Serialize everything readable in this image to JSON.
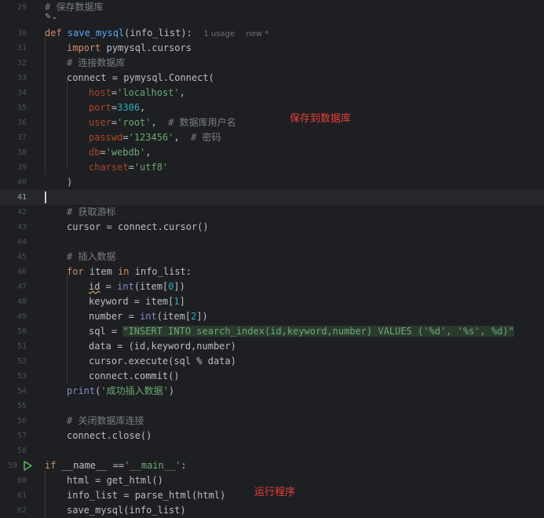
{
  "editor": {
    "line_numbers": [
      "29",
      "30",
      "31",
      "32",
      "33",
      "34",
      "35",
      "36",
      "37",
      "38",
      "39",
      "40",
      "41",
      "42",
      "43",
      "44",
      "45",
      "46",
      "47",
      "48",
      "49",
      "50",
      "51",
      "52",
      "53",
      "54",
      "55",
      "56",
      "57",
      "58",
      "59",
      "60",
      "61",
      "62"
    ],
    "comment_save_db": "# 保存数据库",
    "ai_hint": "✎⌄",
    "def_kw": "def",
    "def_name": "save_mysql",
    "def_params": "(info_list):",
    "usage_hint": "1 usage",
    "new_hint": "new *",
    "import_kw": "import",
    "import_mod": "pymysql.cursors",
    "comment_connect": "# 连接数据库",
    "connect_line": "connect = pymysql.Connect(",
    "host_key": "host",
    "host_val": "'localhost'",
    "port_key": "port",
    "port_val": "3306",
    "user_key": "user",
    "user_val": "'root'",
    "user_comment": "# 数据库用户名",
    "passwd_key": "passwd",
    "passwd_val": "'123456'",
    "passwd_comment": "# 密码",
    "db_key": "db",
    "db_val": "'webdb'",
    "charset_key": "charset",
    "charset_val": "'utf8'",
    "close_paren": ")",
    "comment_cursor": "# 获取游标",
    "cursor_line": "cursor = connect.cursor()",
    "comment_insert": "# 插入数据",
    "for_kw": "for",
    "for_var": "item",
    "in_kw": "in",
    "for_iter": "info_list:",
    "id_var": "id",
    "int_fn": "int",
    "item0": "(item[",
    "idx0": "0",
    "idx_close": "])",
    "keyword_line": "keyword = item[",
    "idx1": "1",
    "bracket_close": "]",
    "number_line": "number = ",
    "item2": "(item[",
    "idx2": "2",
    "sql_prefix": "sql = ",
    "sql_string": "\"INSERT INTO search_index(id,keyword,number) VALUES ('%d', '%s', %d)\"",
    "data_line": "data = (id,keyword,number)",
    "execute_line": "cursor.execute(sql % data)",
    "commit_line": "connect.commit()",
    "print_fn": "print",
    "print_arg": "'成功插入数据'",
    "comment_close": "# 关闭数据库连接",
    "close_line": "connect.close()",
    "if_kw": "if",
    "main_cond_a": "__name__ ==",
    "main_str": "'__main__'",
    "main_colon": ":",
    "html_line": "html = get_html()",
    "parse_line": "info_list = parse_html(html)",
    "save_call": "save_mysql(info_list)"
  },
  "annotations": {
    "save_label": "保存到数据库",
    "run_label": "运行程序"
  },
  "colors": {
    "background": "#1e1f22",
    "keyword": "#cf8e6d",
    "function": "#56a8f5",
    "string": "#6aab73",
    "number": "#2aacb8",
    "comment": "#7a7e85",
    "annotation_red": "#e8403a",
    "run_green": "#5fb865"
  },
  "icons": {
    "run": "run-gutter-icon"
  }
}
